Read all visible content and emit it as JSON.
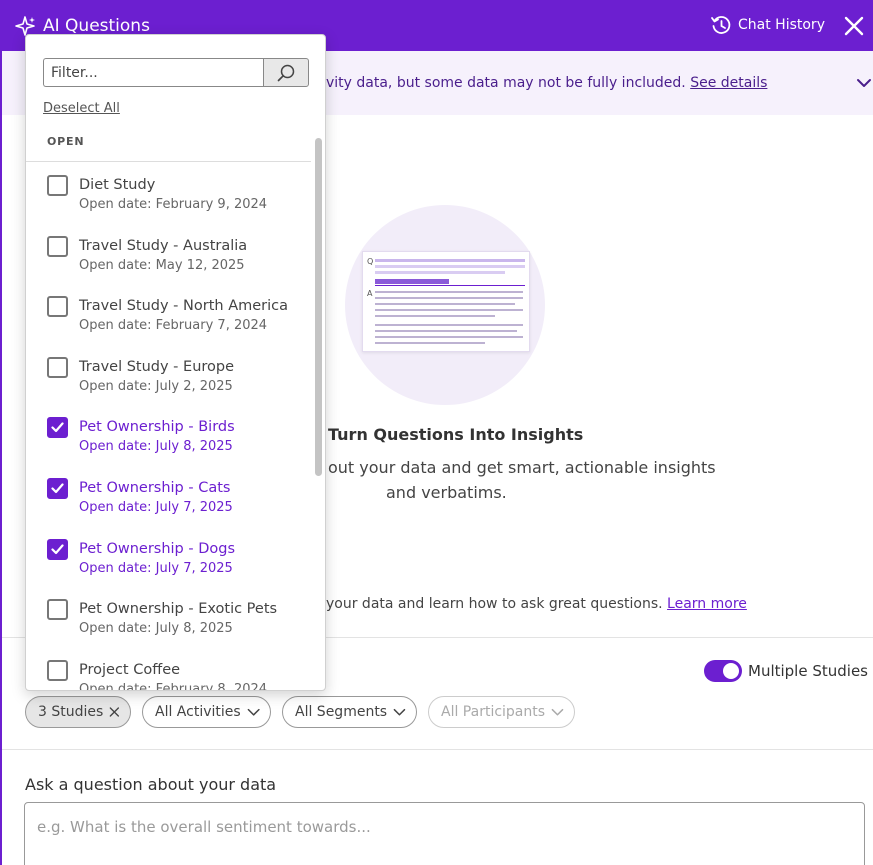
{
  "header": {
    "title": "AI Questions",
    "chat_history_label": "Chat History"
  },
  "notice": {
    "text": "vity data, but some data may not be fully included.",
    "link": "See details"
  },
  "main": {
    "illustration_q": "Q",
    "illustration_a": "A",
    "heading": "Turn Questions Into Insights",
    "subtitle_line1": "out your data and get smart, actionable insights",
    "subtitle_line2": "and verbatims.",
    "learn_text": "your data and learn how to ask great questions.",
    "learn_link": "Learn more"
  },
  "toolbar": {
    "toggle_label": "Multiple Studies",
    "toggle_on": true,
    "chips": {
      "studies": "3 Studies",
      "activities": "All Activities",
      "segments": "All Segments",
      "participants": "All Participants"
    }
  },
  "ask": {
    "label": "Ask a question about your data",
    "placeholder": "e.g. What is the overall sentiment towards..."
  },
  "dropdown": {
    "filter_placeholder": "Filter...",
    "deselect_all": "Deselect All",
    "section_label": "OPEN",
    "items": [
      {
        "name": "Diet Study",
        "date": "Open date: February 9, 2024",
        "checked": false
      },
      {
        "name": "Travel Study - Australia",
        "date": "Open date: May 12, 2025",
        "checked": false
      },
      {
        "name": "Travel Study - North America",
        "date": "Open date: February 7, 2024",
        "checked": false
      },
      {
        "name": "Travel Study - Europe",
        "date": "Open date: July 2, 2025",
        "checked": false
      },
      {
        "name": "Pet Ownership - Birds",
        "date": "Open date: July 8, 2025",
        "checked": true
      },
      {
        "name": "Pet Ownership - Cats",
        "date": "Open date: July 7, 2025",
        "checked": true
      },
      {
        "name": "Pet Ownership - Dogs",
        "date": "Open date: July 7, 2025",
        "checked": true
      },
      {
        "name": "Pet Ownership - Exotic Pets",
        "date": "Open date: July 8, 2025",
        "checked": false
      },
      {
        "name": "Project Coffee",
        "date": "Open date: February 8, 2024",
        "checked": false
      }
    ]
  },
  "colors": {
    "brand": "#6c1fd0",
    "notice_bg": "#f6f1fc",
    "illustration_bg": "#f2edf9"
  }
}
